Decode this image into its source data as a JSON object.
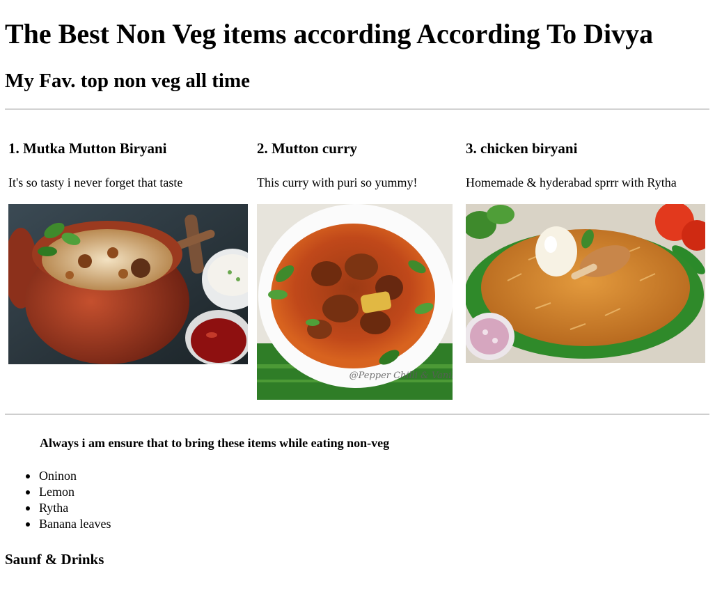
{
  "page": {
    "title": "The Best Non Veg items according According To Divya",
    "subtitle": "My Fav. top non veg all time"
  },
  "items": [
    {
      "title": "1. Mutka Mutton Biryani",
      "description": "It's so tasty i never forget that taste",
      "image_icon": "clay-pot-biryani-photo"
    },
    {
      "title": "2. Mutton curry",
      "description": "This curry with puri so yummy!",
      "image_icon": "mutton-curry-bowl-photo",
      "image_watermark": "@Pepper Chilli & Vanilla"
    },
    {
      "title": "3. chicken biryani",
      "description": "Homemade & hyderabad sprrr with Rytha",
      "image_icon": "chicken-biryani-banana-leaf-photo"
    }
  ],
  "accompaniments": {
    "heading": "Always i am ensure that to bring these items while eating non-veg",
    "list": [
      "Oninon",
      "Lemon",
      "Rytha",
      "Banana leaves"
    ]
  },
  "footer": {
    "heading": "Saunf & Drinks"
  },
  "colors": {
    "text": "#000000",
    "rule": "#a3a3a3",
    "background": "#ffffff"
  }
}
